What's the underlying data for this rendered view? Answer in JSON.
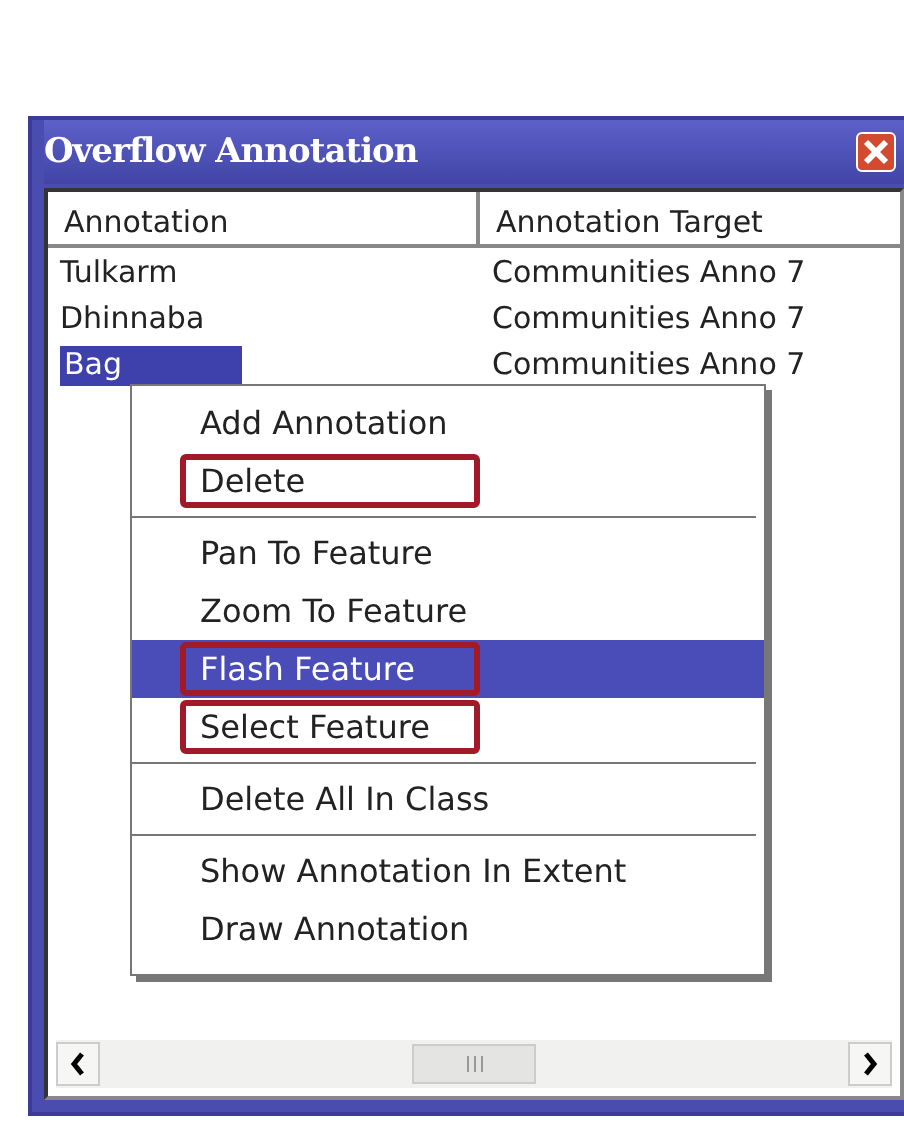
{
  "window": {
    "title": "Overflow Annotation"
  },
  "table": {
    "columns": [
      "Annotation",
      "Annotation Target"
    ],
    "rows": [
      {
        "cells": [
          "Tulkarm",
          "Communities Anno 7"
        ],
        "selected": false
      },
      {
        "cells": [
          "Dhinnaba",
          "Communities Anno 7"
        ],
        "selected": false
      },
      {
        "cells": [
          "Bag",
          "Communities Anno 7"
        ],
        "selected": true
      }
    ]
  },
  "context_menu": {
    "groups": [
      [
        {
          "label": "Add Annotation",
          "selected": false,
          "highlighted": false
        },
        {
          "label": "Delete",
          "selected": false,
          "highlighted": true
        }
      ],
      [
        {
          "label": "Pan To Feature",
          "selected": false,
          "highlighted": false
        },
        {
          "label": "Zoom To Feature",
          "selected": false,
          "highlighted": false
        },
        {
          "label": "Flash Feature",
          "selected": true,
          "highlighted": true
        },
        {
          "label": "Select Feature",
          "selected": false,
          "highlighted": true
        }
      ],
      [
        {
          "label": "Delete All In Class",
          "selected": false,
          "highlighted": false
        }
      ],
      [
        {
          "label": "Show Annotation In Extent",
          "selected": false,
          "highlighted": false
        },
        {
          "label": "Draw Annotation",
          "selected": false,
          "highlighted": false
        }
      ]
    ]
  }
}
